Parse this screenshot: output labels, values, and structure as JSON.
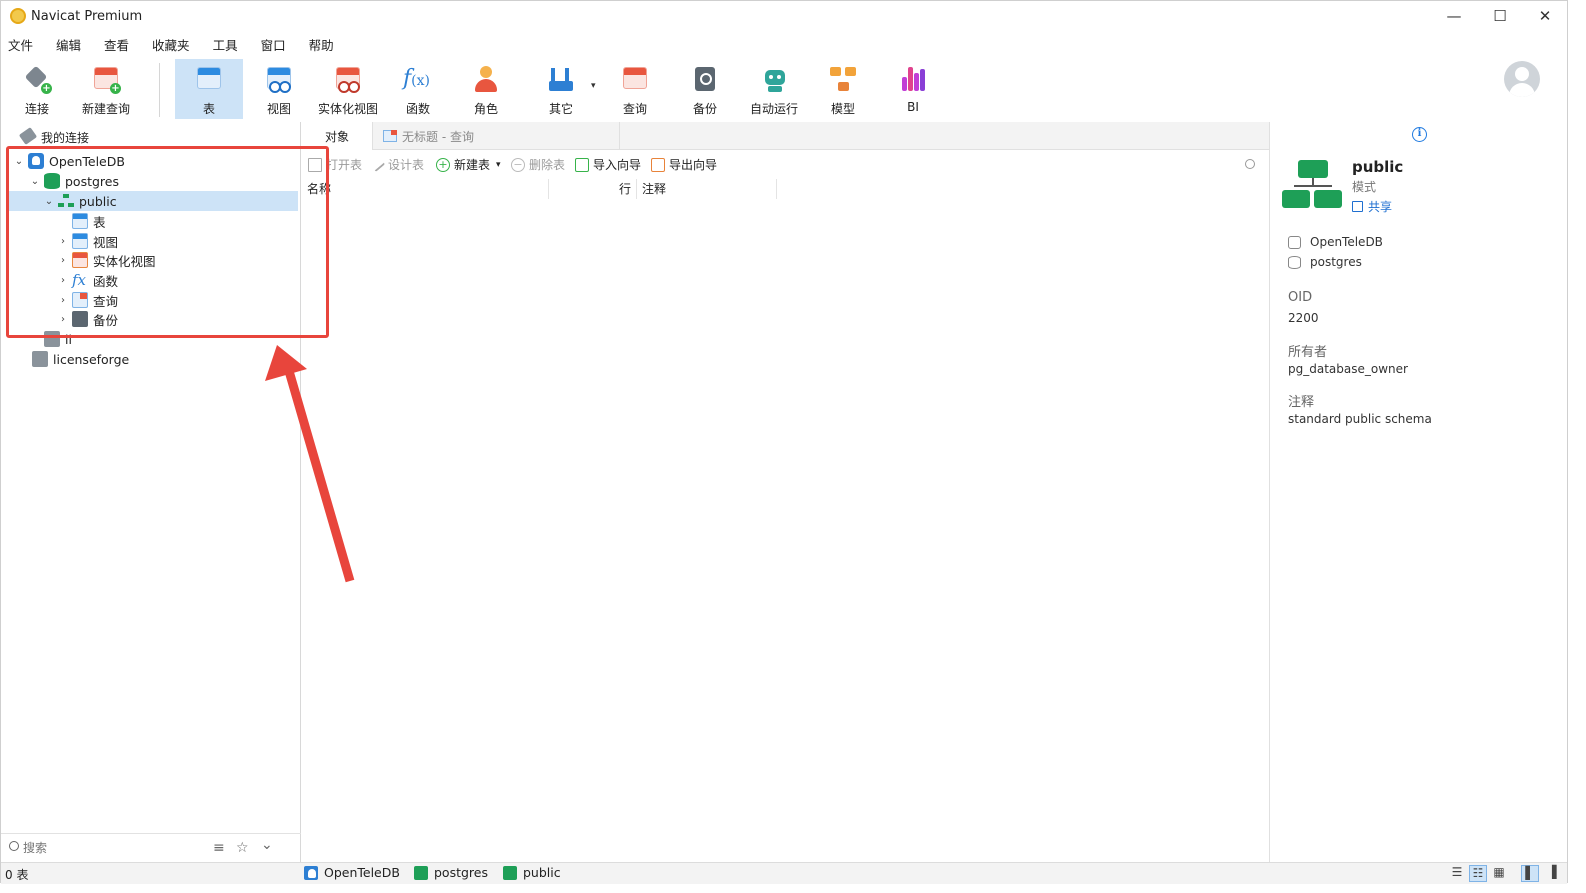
{
  "window": {
    "title": "Navicat Premium",
    "minimize": "—",
    "maximize": "☐",
    "close": "✕"
  },
  "menu": [
    "文件",
    "编辑",
    "查看",
    "收藏夹",
    "工具",
    "窗口",
    "帮助"
  ],
  "toolbar": {
    "items": [
      {
        "label": "连接",
        "icon": "connection-icon"
      },
      {
        "label": "新建查询",
        "icon": "new-query-icon"
      },
      {
        "label": "表",
        "icon": "table-icon",
        "active": true
      },
      {
        "label": "视图",
        "icon": "view-icon"
      },
      {
        "label": "实体化视图",
        "icon": "materialized-view-icon"
      },
      {
        "label": "函数",
        "icon": "function-icon"
      },
      {
        "label": "角色",
        "icon": "role-icon"
      },
      {
        "label": "其它",
        "icon": "others-icon"
      },
      {
        "label": "查询",
        "icon": "query-icon"
      },
      {
        "label": "备份",
        "icon": "backup-icon"
      },
      {
        "label": "自动运行",
        "icon": "automation-icon"
      },
      {
        "label": "模型",
        "icon": "model-icon"
      },
      {
        "label": "BI",
        "icon": "bi-icon"
      }
    ],
    "fx_text": "f",
    "fx_sub": "(x)"
  },
  "nav": {
    "header": "我的连接",
    "tree": {
      "connection": "OpenTeleDB",
      "database": "postgres",
      "schema": "public",
      "children": [
        "表",
        "视图",
        "实体化视图",
        "函数",
        "查询",
        "备份"
      ],
      "other_connections": [
        "ll",
        "licenseforge"
      ]
    },
    "search_placeholder": "搜索",
    "filter_icon": "≡",
    "star_icon": "☆",
    "collapse_icon": "⌄"
  },
  "tabs": {
    "objects": "对象",
    "query": "无标题 - 查询"
  },
  "object_toolbar": {
    "open": "打开表",
    "design": "设计表",
    "new": "新建表",
    "delete": "删除表",
    "import": "导入向导",
    "export": "导出向导",
    "dropdown": "▾",
    "plus": "+",
    "minus": "−"
  },
  "grid_columns": [
    "名称",
    "行",
    "注释"
  ],
  "info_panel": {
    "info": "i",
    "title": "public",
    "subtitle": "模式",
    "share": "共享",
    "connection": "OpenTeleDB",
    "database": "postgres",
    "oid_label": "OID",
    "oid": "2200",
    "owner_label": "所有者",
    "owner": "pg_database_owner",
    "comment_label": "注释",
    "comment": "standard public schema"
  },
  "status": {
    "count": "0 表",
    "connection": "OpenTeleDB",
    "database": "postgres",
    "schema": "public"
  },
  "colors": {
    "accent_blue": "#2d8be0",
    "selection": "#cde3f7",
    "annotation_red": "#e8453c",
    "green": "#1e9f57"
  }
}
